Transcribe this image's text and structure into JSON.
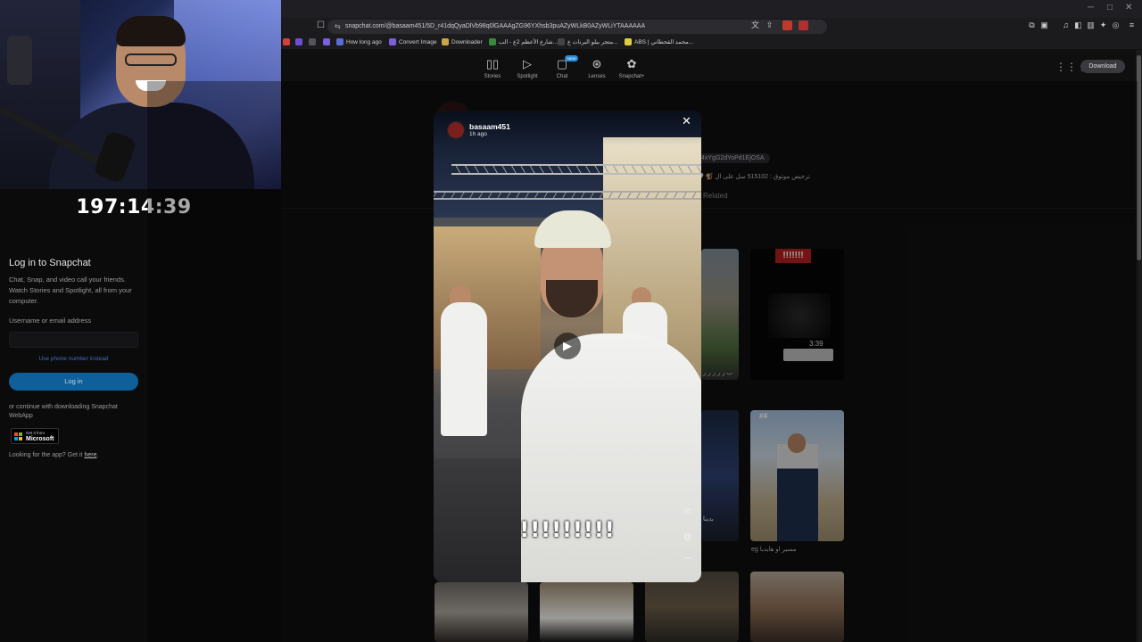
{
  "stream": {
    "timer": "197:14:39"
  },
  "browser": {
    "url": "snapchat.com/@basaam451/5D_r41dqQyaDlVb98q0lGAAAgZG96YXhsb3puAZyWLkB0AZyWLiYTAAAAAA",
    "bookmarks": [
      {
        "label": "How long ago"
      },
      {
        "label": "Convert Image"
      },
      {
        "label": "Downloader"
      },
      {
        "label": "شارع الأعظم 2ع - الب..."
      },
      {
        "label": "متجر بيلو البرنات ع..."
      },
      {
        "label": "ABS | محمد القحطاني..."
      }
    ]
  },
  "topnav": {
    "items": [
      {
        "label": "Stories",
        "icon": "stories-icon"
      },
      {
        "label": "Spotlight",
        "icon": "spotlight-icon"
      },
      {
        "label": "Chat",
        "icon": "chat-icon",
        "badge": "NEW"
      },
      {
        "label": "Lenses",
        "icon": "lenses-icon"
      },
      {
        "label": "Snapchat+",
        "icon": "snapchat-plus-icon"
      }
    ],
    "download_label": "Download"
  },
  "login": {
    "title": "Log in to Snapchat",
    "description": "Chat, Snap, and video call your friends. Watch Stories and Spotlight, all from your computer.",
    "username_label": "Username or email address",
    "username_value": "",
    "phone_link": "Use phone number instead",
    "login_button": "Log in",
    "continue_text": "or continue with downloading Snapchat WebApp",
    "store_badge_small": "Get it from",
    "store_badge_big": "Microsoft",
    "app_text": "Looking for the app? Get it",
    "app_link": "here"
  },
  "profile": {
    "code_chip": "4xYgG2dYoPd1EjOSA",
    "bio": "🤍 🐒 ترخيص موثوق : 515102 سل على ال",
    "related_tab": "Related"
  },
  "tiles": {
    "tile1_caption": "ب ر ر ر ر ر",
    "tile2_overlay": "!!!!!!!",
    "tile2_time": "3:39",
    "tile3_caption": "بدينا",
    "tile4_badge": "#4",
    "tile4_caption": "eg مسير او هايدبا"
  },
  "modal": {
    "username": "basaam451",
    "time": "1h ago",
    "caption": "!!!!!!!!!"
  },
  "colors": {
    "page_bg": "#0f0f10",
    "login_button": "#0e5f9a",
    "accent_link": "#3b6fc0"
  }
}
